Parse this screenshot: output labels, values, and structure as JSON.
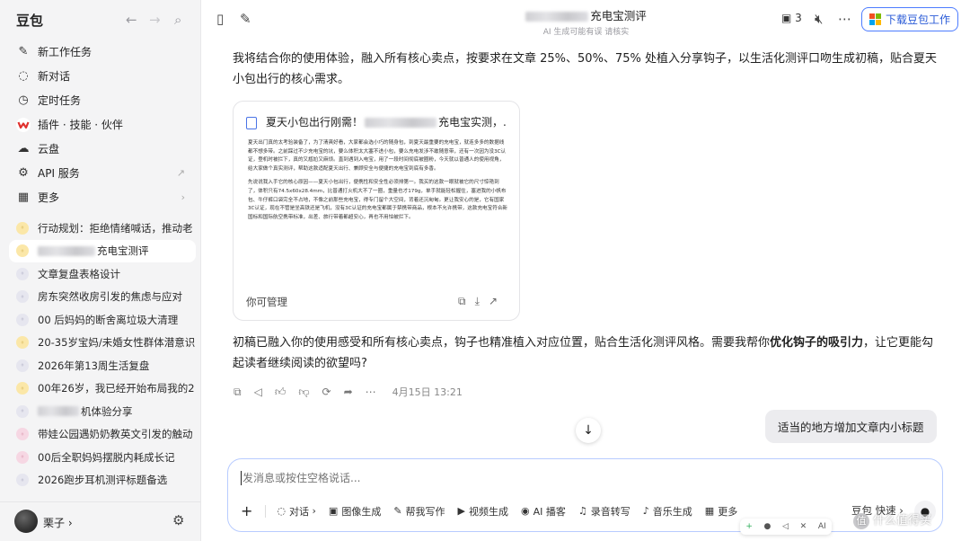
{
  "sidebar": {
    "app_name": "豆包",
    "menu": [
      {
        "label": "新工作任务",
        "icon": "edit-icon"
      },
      {
        "label": "新对话",
        "icon": "chat-icon"
      },
      {
        "label": "定时任务",
        "icon": "clock-icon"
      },
      {
        "label": "插件 · 技能 · 伙伴",
        "icon": "wps-icon"
      },
      {
        "label": "云盘",
        "icon": "cloud-icon"
      },
      {
        "label": "API 服务",
        "icon": "api-icon"
      },
      {
        "label": "更多",
        "icon": "grid-icon"
      }
    ],
    "chats": [
      {
        "label": "行动规划：拒绝情绪喊话，推动老"
      },
      {
        "label": "充电宝测评"
      },
      {
        "label": "文章复盘表格设计"
      },
      {
        "label": "房东突然收房引发的焦虑与应对"
      },
      {
        "label": "00 后妈妈的断舍离垃圾大清理"
      },
      {
        "label": "20-35岁宝妈/未婚女性群体潜意识"
      },
      {
        "label": "2026年第13周生活复盘"
      },
      {
        "label": "00年26岁，我已经开始布局我的2"
      },
      {
        "label": "机体验分享"
      },
      {
        "label": "带娃公园遇奶奶教英文引发的触动"
      },
      {
        "label": "00后全职妈妈摆脱内耗成长记"
      },
      {
        "label": "2026跑步耳机测评标题备选"
      }
    ],
    "user": {
      "name": "栗子"
    }
  },
  "header": {
    "title": "充电宝测评",
    "subtitle": "AI 生成可能有误 请核实",
    "count": "3",
    "download_label": "下载豆包工作"
  },
  "conversation": {
    "intro": "我将结合你的使用体验，融入所有核心卖点，按要求在文章 25%、50%、75% 处植入分享钩子，以生活化测评口吻生成初稿，贴合夏天小包出行的核心需求。",
    "card": {
      "title": "夏天小包出行刚需！",
      "title_suffix": "充电宝实测，...",
      "para1": "夏天出门真的太考验装备了，为了清爽好看，大家都会选小巧的随身包，到夏天最重要的充电宝，就连多多的数据线都不想多带。之前踩过不少充电宝的坑，要么体积太大塞不进小包，要么充电发涉不敢随意带，还有一次因为没3C认证，登机时被拦下，真的又尴尬又麻烦。直到遇到入电宝，用了一段时间彻底被圈粉，今天就以普通人的使用视角，给大家做个真实测评，帮助这款适配夏天出行、兼顾安全与便捷的充电宝到底有多香。",
      "para2": "先说说我入手它的核心原因——夏天小包出行，便携性和安全性必须排第一。我买的这款一眼就被它的尺寸惊艳到了，体积只有74.5x60x28.4mm，比普通打火机大不了一圈，重量也才179g，单手就能轻松握住，塞进我的小帆布包、牛仔裤口袋完全不占地，不像之前那些充电宝，得专门留个大空间，背着还沉甸甸。更让我安心的是，它有国家3C认证，现在不管是坐高铁还是飞机，没有3C认证的充电宝都属于禁携带商品，根本不允许携带，这款充电宝符合新国标和国际航空携带标准，出差、旅行带着都超安心，再也不用怕被拦下。",
      "footer": "你可管理"
    },
    "reply_prefix": "初稿已融入你的使用感受和所有核心卖点，钩子也精准植入对应位置，贴合生活化测评风格。需要我帮你",
    "reply_bold": "优化钩子的吸引力",
    "reply_suffix": "，让它更能勾起读者继续阅读的欲望吗?",
    "timestamp": "4月15日 13:21",
    "user_message": "适当的地方增加文章内小标题"
  },
  "composer": {
    "placeholder": "发消息或按住空格说话...",
    "tools": [
      "对话",
      "图像生成",
      "帮我写作",
      "视频生成",
      "AI 播客",
      "录音转写",
      "音乐生成",
      "更多"
    ],
    "mode": "豆包 快速"
  },
  "watermark": "什么值得买",
  "colors": {
    "accent": "#4d7cff",
    "sidebar_bg": "#f4f4f5",
    "wps_red": "#e0302d"
  }
}
